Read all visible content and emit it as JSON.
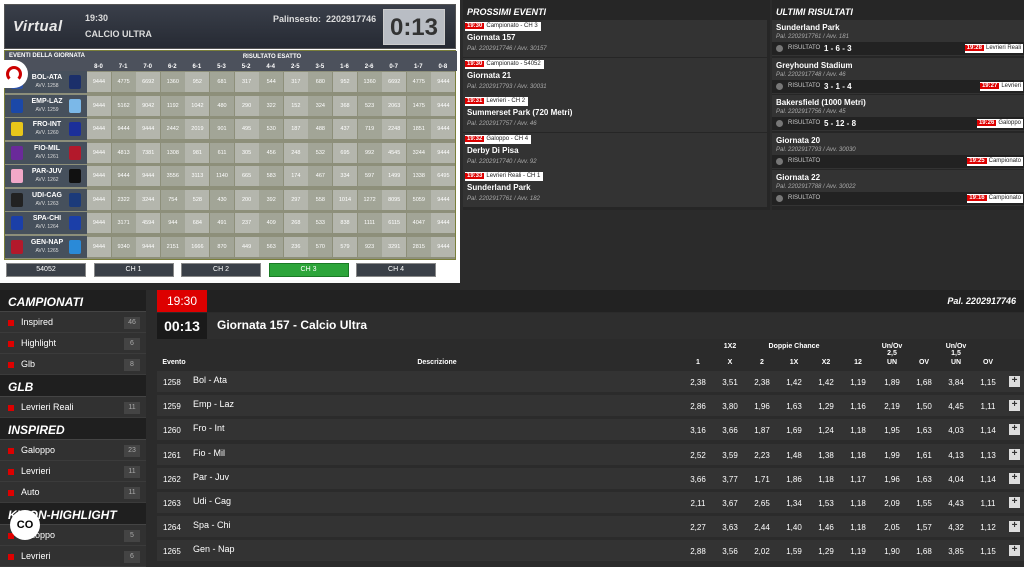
{
  "virtual": {
    "logo": "Virtual",
    "time": "19:30",
    "name": "CALCIO ULTRA",
    "palinsesto_label": "Palinsesto:",
    "palinsesto": "2202917746",
    "clock": "0:13",
    "grid_title": "EVENTI DELLA GIORNATA",
    "grid_title2": "RISULTATO ESATTO",
    "score_cols": [
      "8-0",
      "7-1",
      "7-0",
      "6-2",
      "6-1",
      "5-3",
      "5-2",
      "4-4",
      "2-5",
      "3-5",
      "1-6",
      "2-6",
      "0-7",
      "1-7",
      "0-8"
    ],
    "rows": [
      {
        "team": "BOL-ATA",
        "avv": "AVV. 1258",
        "c1": "#2a4fa3",
        "c2": "#1b2f6a",
        "vals": [
          "9444",
          "4775",
          "6692",
          "1360",
          "952",
          "681",
          "317",
          "544",
          "317",
          "680",
          "952",
          "1360",
          "6692",
          "4775",
          "9444"
        ]
      },
      {
        "team": "EMP-LAZ",
        "avv": "AVV. 1259",
        "c1": "#1b48a8",
        "c2": "#7bb8e8",
        "vals": [
          "9444",
          "5162",
          "9042",
          "1192",
          "1042",
          "480",
          "290",
          "322",
          "152",
          "324",
          "368",
          "523",
          "2063",
          "1475",
          "9444"
        ]
      },
      {
        "team": "FRO-INT",
        "avv": "AVV. 1260",
        "c1": "#e8c61a",
        "c2": "#1b2f9a",
        "vals": [
          "9444",
          "9444",
          "9444",
          "2442",
          "2019",
          "901",
          "495",
          "530",
          "187",
          "488",
          "437",
          "719",
          "2248",
          "1851",
          "9444"
        ]
      },
      {
        "team": "FIO-MIL",
        "avv": "AVV. 1261",
        "c1": "#6a2a9a",
        "c2": "#b3192b",
        "vals": [
          "9444",
          "4813",
          "7381",
          "1308",
          "981",
          "611",
          "305",
          "456",
          "248",
          "532",
          "695",
          "992",
          "4545",
          "3244",
          "9444"
        ]
      },
      {
        "team": "PAR-JUV",
        "avv": "AVV. 1262",
        "c1": "#f1a8c8",
        "c2": "#111111",
        "vals": [
          "9444",
          "9444",
          "9444",
          "3556",
          "3113",
          "1140",
          "665",
          "583",
          "174",
          "467",
          "334",
          "597",
          "1499",
          "1338",
          "6495"
        ]
      },
      {
        "team": "UDI-CAG",
        "avv": "AVV. 1263",
        "c1": "#222222",
        "c2": "#1b3a7a",
        "vals": [
          "9444",
          "2322",
          "3244",
          "754",
          "528",
          "430",
          "200",
          "392",
          "297",
          "558",
          "1014",
          "1272",
          "8095",
          "5059",
          "9444"
        ]
      },
      {
        "team": "SPA-CHI",
        "avv": "AVV. 1264",
        "c1": "#1b3fa8",
        "c2": "#1b3fa8",
        "vals": [
          "9444",
          "3171",
          "4594",
          "944",
          "684",
          "491",
          "237",
          "409",
          "268",
          "533",
          "838",
          "1111",
          "6115",
          "4047",
          "9444"
        ]
      },
      {
        "team": "GEN-NAP",
        "avv": "AVV. 1265",
        "c1": "#b3192b",
        "c2": "#2a8ad8",
        "vals": [
          "9444",
          "9340",
          "9444",
          "2151",
          "1666",
          "870",
          "449",
          "563",
          "236",
          "570",
          "579",
          "923",
          "3291",
          "2815",
          "9444"
        ]
      }
    ],
    "tabs": [
      {
        "label": "54052",
        "active": false
      },
      {
        "label": "CH 1",
        "active": false
      },
      {
        "label": "CH 2",
        "active": false
      },
      {
        "label": "CH 3",
        "active": true
      },
      {
        "label": "CH 4",
        "active": false
      }
    ]
  },
  "prossimi": {
    "title": "PROSSIMI EVENTI",
    "items": [
      {
        "time": "19:30",
        "tag": "Campionato - CH 3",
        "name": "Giornata 157",
        "pal": "Pal. 2202917746 / Avv. 30157"
      },
      {
        "time": "19:30",
        "tag": "Campionato - 54052",
        "name": "Giornata 21",
        "pal": "Pal. 2202917793 / Avv. 30031"
      },
      {
        "time": "19:31",
        "tag": "Levrieri - CH 2",
        "name": "Summerset Park (720 Metri)",
        "pal": "Pal. 2202917757 / Avv. 46"
      },
      {
        "time": "19:32",
        "tag": "Galoppo - CH 4",
        "name": "Derby Di Pisa",
        "pal": "Pal. 2202917740 / Avv. 92"
      },
      {
        "time": "19:33",
        "tag": "Levrieri Reali - CH 1",
        "name": "Sunderland Park",
        "pal": "Pal. 2202917761 / Avv. 182"
      }
    ]
  },
  "ultimi": {
    "title": "ULTIMI RISULTATI",
    "items": [
      {
        "name": "Sunderland Park",
        "pal": "Pal. 2202917761 / Avv. 181",
        "label": "RISULTATO",
        "score": "1 - 6 - 3",
        "time": "19:28",
        "tag": "Levrieri Reali"
      },
      {
        "name": "Greyhound Stadium",
        "pal": "Pal. 2202917748 / Avv. 46",
        "label": "RISULTATO",
        "score": "3 - 1 - 4",
        "time": "19:27",
        "tag": "Levrieri"
      },
      {
        "name": "Bakersfield (1000 Metri)",
        "pal": "Pal. 2202917756 / Avv. 45",
        "label": "RISULTATO",
        "score": "5 - 12 - 8",
        "time": "19:26",
        "tag": "Galoppo"
      },
      {
        "name": "Giornata 20",
        "pal": "Pal. 2202917793 / Avv. 30030",
        "label": "RISULTATO",
        "score": "",
        "time": "19:25",
        "tag": "Campionato"
      },
      {
        "name": "Giornata 22",
        "pal": "Pal. 2202917788 / Avv. 30022",
        "label": "RISULTATO",
        "score": "",
        "time": "19:16",
        "tag": "Campionato"
      }
    ]
  },
  "sidebar": {
    "sections": [
      {
        "title": "CAMPIONATI",
        "items": [
          {
            "label": "Inspired",
            "count": "46"
          },
          {
            "label": "Highlight",
            "count": "6"
          },
          {
            "label": "Glb",
            "count": "8"
          }
        ]
      },
      {
        "title": "GLB",
        "items": [
          {
            "label": "Levrieri Reali",
            "count": "11"
          }
        ]
      },
      {
        "title": "INSPIRED",
        "items": [
          {
            "label": "Galoppo",
            "count": "23"
          },
          {
            "label": "Levrieri",
            "count": "11"
          },
          {
            "label": "Auto",
            "count": "11"
          }
        ]
      },
      {
        "title": "KIRON-HIGHLIGHT",
        "items": [
          {
            "label": "Galoppo",
            "count": "5"
          },
          {
            "label": "Levrieri",
            "count": "6"
          }
        ]
      }
    ],
    "chat_btn": "CO"
  },
  "main": {
    "time": "19:30",
    "pal": "Pal. 2202917746",
    "countdown": "00:13",
    "title": "Giornata 157 - Calcio Ultra",
    "group_heads": [
      "1X2",
      "Doppie Chance",
      "Un/Ov 2,5",
      "Un/Ov 1,5"
    ],
    "col_heads": [
      "Evento",
      "Descrizione",
      "1",
      "X",
      "2",
      "1X",
      "X2",
      "12",
      "UN",
      "OV",
      "UN",
      "OV"
    ],
    "rows": [
      {
        "ev": "1258",
        "desc": "Bol - Ata",
        "odds": [
          "2,38",
          "3,51",
          "2,38",
          "1,42",
          "1,42",
          "1,19",
          "1,89",
          "1,68",
          "3,84",
          "1,15"
        ]
      },
      {
        "ev": "1259",
        "desc": "Emp - Laz",
        "odds": [
          "2,86",
          "3,80",
          "1,96",
          "1,63",
          "1,29",
          "1,16",
          "2,19",
          "1,50",
          "4,45",
          "1,11"
        ]
      },
      {
        "ev": "1260",
        "desc": "Fro - Int",
        "odds": [
          "3,16",
          "3,66",
          "1,87",
          "1,69",
          "1,24",
          "1,18",
          "1,95",
          "1,63",
          "4,03",
          "1,14"
        ]
      },
      {
        "ev": "1261",
        "desc": "Fio - Mil",
        "odds": [
          "2,52",
          "3,59",
          "2,23",
          "1,48",
          "1,38",
          "1,18",
          "1,99",
          "1,61",
          "4,13",
          "1,13"
        ]
      },
      {
        "ev": "1262",
        "desc": "Par - Juv",
        "odds": [
          "3,66",
          "3,77",
          "1,71",
          "1,86",
          "1,18",
          "1,17",
          "1,96",
          "1,63",
          "4,04",
          "1,14"
        ]
      },
      {
        "ev": "1263",
        "desc": "Udi - Cag",
        "odds": [
          "2,11",
          "3,67",
          "2,65",
          "1,34",
          "1,53",
          "1,18",
          "2,09",
          "1,55",
          "4,43",
          "1,11"
        ]
      },
      {
        "ev": "1264",
        "desc": "Spa - Chi",
        "odds": [
          "2,27",
          "3,63",
          "2,44",
          "1,40",
          "1,46",
          "1,18",
          "2,05",
          "1,57",
          "4,32",
          "1,12"
        ]
      },
      {
        "ev": "1265",
        "desc": "Gen - Nap",
        "odds": [
          "2,88",
          "3,56",
          "2,02",
          "1,59",
          "1,29",
          "1,19",
          "1,90",
          "1,68",
          "3,85",
          "1,15"
        ]
      }
    ]
  }
}
